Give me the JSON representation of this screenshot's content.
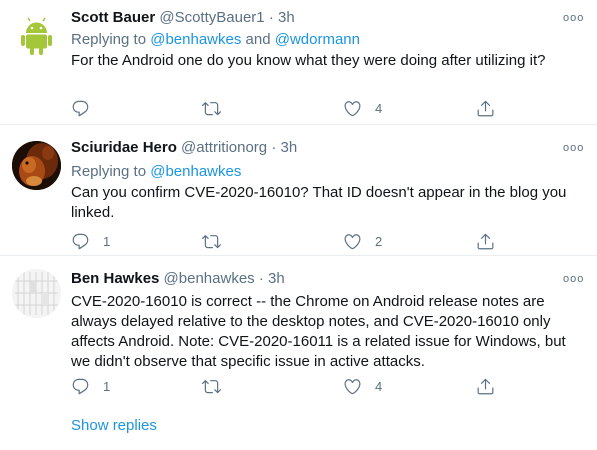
{
  "tweets": [
    {
      "name": "Scott Bauer",
      "handle": "@ScottyBauer1",
      "dot": "·",
      "time": "3h",
      "replying_prefix": "Replying to ",
      "mentions": [
        "@benhawkes",
        "@wdormann"
      ],
      "mention_joiner": " and ",
      "body": "For the Android one do you know what they were doing after utilizing it?",
      "reply_count": "",
      "retweet_count": "",
      "like_count": "4",
      "avatar_icon": "android-icon"
    },
    {
      "name": "Sciuridae Hero",
      "handle": "@attritionorg",
      "dot": "·",
      "time": "3h",
      "replying_prefix": "Replying to ",
      "mentions": [
        "@benhawkes"
      ],
      "mention_joiner": "",
      "body": "Can you confirm CVE-2020-16010? That ID doesn't appear in the blog you linked.",
      "reply_count": "1",
      "retweet_count": "",
      "like_count": "2",
      "avatar_icon": "squirrel-avatar"
    },
    {
      "name": "Ben Hawkes",
      "handle": "@benhawkes",
      "dot": "·",
      "time": "3h",
      "body": "CVE-2020-16010 is correct -- the Chrome on Android release notes are always delayed relative to the desktop notes, and CVE-2020-16010 only affects Android. Note: CVE-2020-16011 is a related issue for Windows, but we didn't observe that specific issue in active attacks.",
      "reply_count": "1",
      "retweet_count": "",
      "like_count": "4",
      "avatar_icon": "pixel-pattern-avatar"
    }
  ],
  "more_label": "ooo",
  "show_replies": "Show replies",
  "colors": {
    "link": "#1b95e0",
    "muted": "#5b7083",
    "text": "#0f1419",
    "divider": "#ebeef0"
  }
}
